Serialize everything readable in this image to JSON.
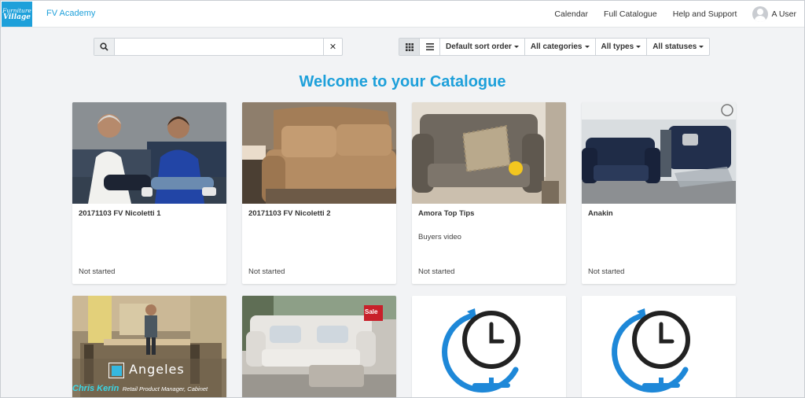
{
  "nav": {
    "logo_line1": "Furniture",
    "logo_line2": "Village",
    "brand": "FV Academy",
    "links": [
      "Calendar",
      "Full Catalogue",
      "Help and Support"
    ],
    "user": "A User"
  },
  "toolbar": {
    "search_placeholder": "",
    "sort": "Default sort order",
    "categories": "All categories",
    "types": "All types",
    "statuses": "All statuses"
  },
  "heading": "Welcome to your Catalogue",
  "cards": [
    {
      "title": "20171103 FV Nicoletti 1",
      "subtitle": "",
      "status": "Not started"
    },
    {
      "title": "20171103 FV Nicoletti 2",
      "subtitle": "",
      "status": "Not started"
    },
    {
      "title": "Amora Top Tips",
      "subtitle": "Buyers video",
      "status": "Not started"
    },
    {
      "title": "Anakin",
      "subtitle": "",
      "status": "Not started"
    }
  ],
  "card5_overlay": {
    "name": "Chris Kerin",
    "role": "Retail Product Manager, Cabinet",
    "brand": "Angeles"
  },
  "card6_sign": "Sale",
  "colors": {
    "accent": "#1ea0da",
    "clock_blue": "#1e88d8"
  }
}
